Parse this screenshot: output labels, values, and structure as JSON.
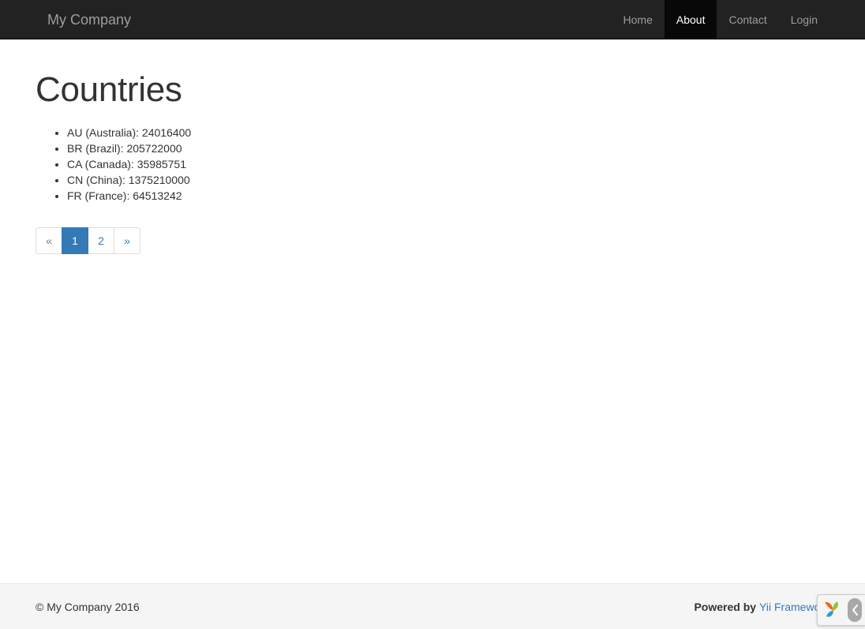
{
  "navbar": {
    "brand": "My Company",
    "items": [
      {
        "label": "Home",
        "active": false
      },
      {
        "label": "About",
        "active": true
      },
      {
        "label": "Contact",
        "active": false
      },
      {
        "label": "Login",
        "active": false
      }
    ]
  },
  "main": {
    "title": "Countries",
    "countries": [
      "AU (Australia): 24016400",
      "BR (Brazil): 205722000",
      "CA (Canada): 35985751",
      "CN (China): 1375210000",
      "FR (France): 64513242"
    ],
    "pagination": [
      {
        "label": "«",
        "state": "disabled"
      },
      {
        "label": "1",
        "state": "active"
      },
      {
        "label": "2",
        "state": "link"
      },
      {
        "label": "»",
        "state": "link"
      }
    ]
  },
  "footer": {
    "copyright": "© My Company 2016",
    "powered_by_prefix": "Powered by",
    "powered_by_link": "Yii Framework"
  },
  "debug_toolbar": {
    "logo_name": "yii-logo-icon",
    "toggle_name": "chevron-left-icon"
  },
  "colors": {
    "navbar_bg": "#222222",
    "navbar_active_bg": "#080808",
    "navbar_text": "#9d9d9d",
    "navbar_active_text": "#ffffff",
    "link_blue": "#337ab7",
    "body_text": "#333333",
    "footer_bg": "#f5f5f5",
    "border": "#dddddd"
  }
}
